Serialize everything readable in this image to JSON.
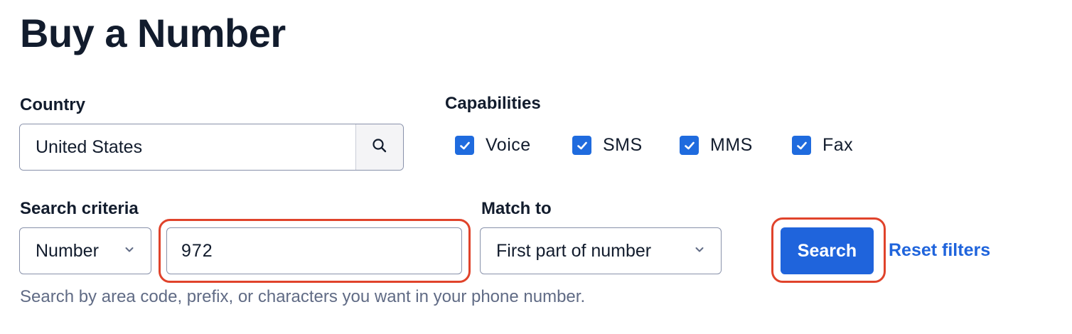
{
  "header": {
    "title": "Buy a Number"
  },
  "country": {
    "label": "Country",
    "value": "United States",
    "search_icon": "search-icon"
  },
  "capabilities": {
    "label": "Capabilities",
    "items": [
      {
        "label": "Voice",
        "checked": true
      },
      {
        "label": "SMS",
        "checked": true
      },
      {
        "label": "MMS",
        "checked": true
      },
      {
        "label": "Fax",
        "checked": true
      }
    ]
  },
  "search_criteria": {
    "label": "Search criteria",
    "selected": "Number",
    "value": "972",
    "help": "Search by area code, prefix, or characters you want in your phone number."
  },
  "match_to": {
    "label": "Match to",
    "selected": "First part of number"
  },
  "actions": {
    "search_label": "Search",
    "reset_label": "Reset filters"
  },
  "colors": {
    "accent": "#1f64dc",
    "highlight": "#e0432b",
    "text": "#121c2d",
    "muted": "#606b85"
  }
}
